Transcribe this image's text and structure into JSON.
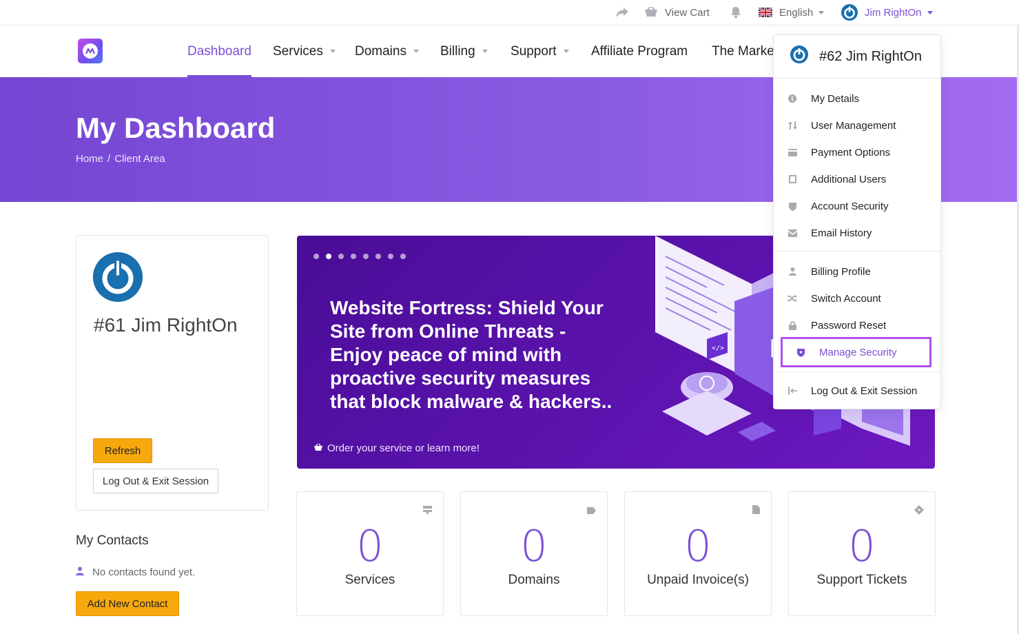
{
  "colors": {
    "accent": "#7b4fd6",
    "orange": "#f7a80d",
    "highlight": "#b14ff0"
  },
  "topbar": {
    "share_icon": "share-icon",
    "view_cart_label": "View Cart",
    "language_label": "English",
    "user_label": "Jim RightOn"
  },
  "nav": {
    "items": [
      {
        "label": "Dashboard"
      },
      {
        "label": "Services"
      },
      {
        "label": "Domains"
      },
      {
        "label": "Billing"
      },
      {
        "label": "Support"
      },
      {
        "label": "Affiliate Program"
      },
      {
        "label": "The Marke"
      }
    ]
  },
  "hero": {
    "title": "My Dashboard",
    "breadcrumb": [
      "Home",
      "/",
      "Client Area"
    ]
  },
  "profile": {
    "name": "#61 Jim RightOn",
    "refresh_label": "Refresh",
    "logout_label": "Log Out & Exit Session"
  },
  "contacts": {
    "title": "My Contacts",
    "empty_text": "No contacts found yet.",
    "add_label": "Add New Contact"
  },
  "banner": {
    "headline": "Website Fortress: Shield Your Site from Online Threats - Enjoy peace of mind with proactive security measures that block malware & hackers..",
    "cta": "Order your service or learn more!",
    "slides": 8,
    "active_slide": 2
  },
  "stats": [
    {
      "value": "0",
      "label": "Services",
      "icon": "server-icon"
    },
    {
      "value": "0",
      "label": "Domains",
      "icon": "tag-icon"
    },
    {
      "value": "0",
      "label": "Unpaid Invoice(s)",
      "icon": "document-icon"
    },
    {
      "value": "0",
      "label": "Support Tickets",
      "icon": "ticket-icon"
    }
  ],
  "dropdown": {
    "header": "#62 Jim RightOn",
    "items": [
      {
        "label": "My Details",
        "icon": "info-icon"
      },
      {
        "label": "User Management",
        "icon": "sort-arrows-icon"
      },
      {
        "label": "Payment Options",
        "icon": "wallet-icon"
      },
      {
        "label": "Additional Users",
        "icon": "square-icon"
      },
      {
        "label": "Account Security",
        "icon": "shield-icon"
      },
      {
        "label": "Email History",
        "icon": "inbox-icon"
      },
      {
        "label": "Billing Profile",
        "icon": "user-icon"
      },
      {
        "label": "Switch Account",
        "icon": "shuffle-icon"
      },
      {
        "label": "Password Reset",
        "icon": "lock-icon"
      },
      {
        "label": "Manage Security",
        "icon": "shield-icon"
      },
      {
        "label": "Log Out & Exit Session",
        "icon": "logout-icon"
      }
    ]
  }
}
